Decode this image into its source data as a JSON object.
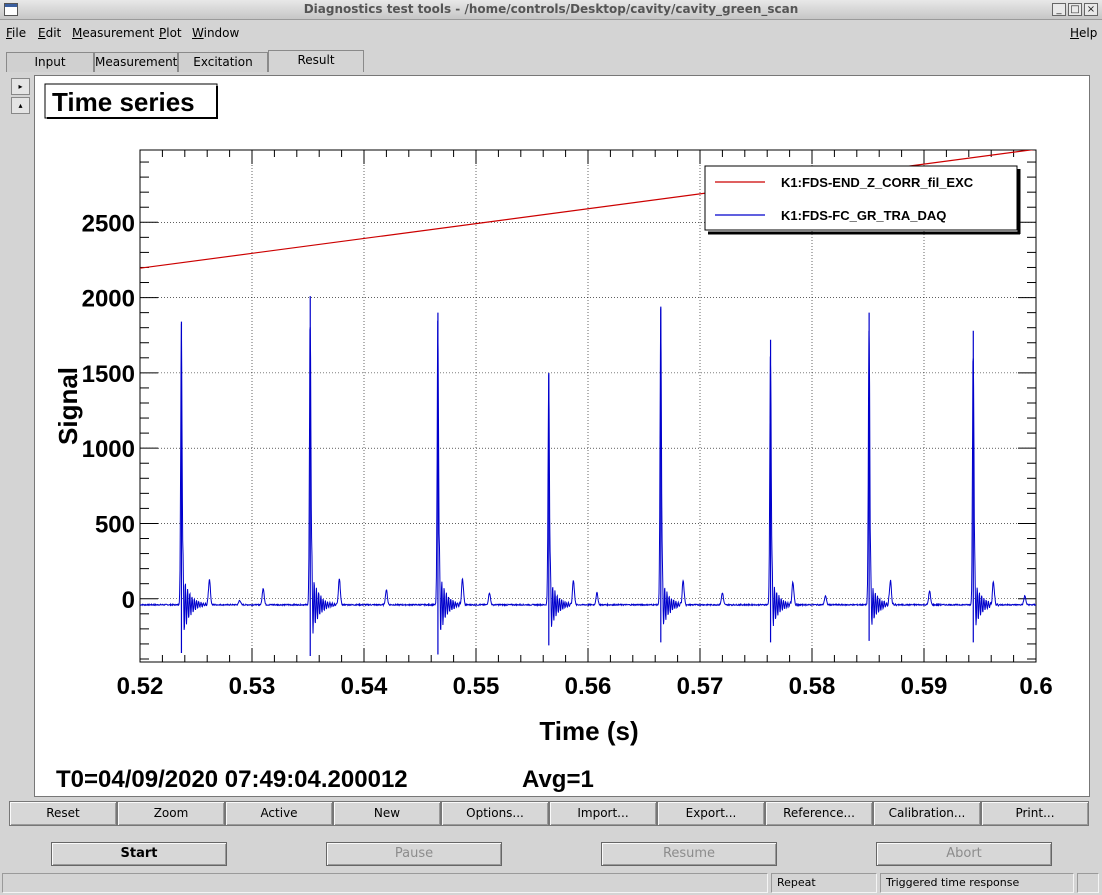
{
  "window": {
    "title": "Diagnostics test tools - /home/controls/Desktop/cavity/cavity_green_scan",
    "controls": [
      "_",
      "□",
      "×"
    ]
  },
  "menubar": {
    "items": [
      {
        "underline": "F",
        "rest": "ile"
      },
      {
        "underline": "E",
        "rest": "dit"
      },
      {
        "underline": "M",
        "rest": "easurement"
      },
      {
        "underline": "P",
        "rest": "lot"
      },
      {
        "underline": "W",
        "rest": "indow"
      }
    ],
    "help": {
      "underline": "H",
      "rest": "elp"
    }
  },
  "tabs": [
    "Input",
    "Measurement",
    "Excitation",
    "Result"
  ],
  "active_tab": "Result",
  "side_buttons": [
    "▸",
    "▴"
  ],
  "plot": {
    "title": "Time series",
    "info_t0": "T0=04/09/2020 07:49:04.200012",
    "info_avg": "Avg=1"
  },
  "chart_data": {
    "type": "line",
    "title": "Time series",
    "xlabel": "Time (s)",
    "ylabel": "Signal",
    "xlim": [
      0.52,
      0.6
    ],
    "ylim": [
      -420,
      2980
    ],
    "grid": true,
    "x_ticks": [
      "0.52",
      "0.53",
      "0.54",
      "0.55",
      "0.56",
      "0.57",
      "0.58",
      "0.59",
      "0.6"
    ],
    "y_ticks": [
      "0",
      "500",
      "1000",
      "1500",
      "2000",
      "2500"
    ],
    "legend_position": "top-right",
    "series": [
      {
        "name": "K1:FDS-END_Z_CORR_fil_EXC",
        "color": "#cc0000",
        "x": [
          0.52,
          0.6
        ],
        "y": [
          2195,
          2985
        ]
      },
      {
        "name": "K1:FDS-FC_GR_TRA_DAQ",
        "color": "#0000cc",
        "baseline": -40,
        "spikes": [
          {
            "x": 0.5237,
            "y": 1840,
            "min": -360
          },
          {
            "x": 0.5352,
            "y": 2010,
            "min": -380
          },
          {
            "x": 0.5466,
            "y": 1900,
            "min": -370
          },
          {
            "x": 0.5565,
            "y": 1500,
            "min": -310
          },
          {
            "x": 0.5665,
            "y": 1940,
            "min": -290
          },
          {
            "x": 0.5763,
            "y": 1720,
            "min": -290
          },
          {
            "x": 0.5851,
            "y": 1900,
            "min": -280
          },
          {
            "x": 0.5944,
            "y": 1780,
            "min": -290
          }
        ],
        "bumps": [
          {
            "x": 0.5262,
            "y": 130
          },
          {
            "x": 0.5289,
            "y": -10
          },
          {
            "x": 0.531,
            "y": 70
          },
          {
            "x": 0.5378,
            "y": 130
          },
          {
            "x": 0.542,
            "y": 60
          },
          {
            "x": 0.5488,
            "y": 130
          },
          {
            "x": 0.5512,
            "y": 40
          },
          {
            "x": 0.5587,
            "y": 120
          },
          {
            "x": 0.5608,
            "y": 40
          },
          {
            "x": 0.5685,
            "y": 120
          },
          {
            "x": 0.572,
            "y": 40
          },
          {
            "x": 0.5783,
            "y": 110
          },
          {
            "x": 0.5812,
            "y": 20
          },
          {
            "x": 0.587,
            "y": 120
          },
          {
            "x": 0.5905,
            "y": 50
          },
          {
            "x": 0.5962,
            "y": 110
          },
          {
            "x": 0.599,
            "y": 20
          }
        ]
      }
    ]
  },
  "toolbar": [
    "Reset",
    "Zoom",
    "Active",
    "New",
    "Options...",
    "Import...",
    "Export...",
    "Reference...",
    "Calibration...",
    "Print..."
  ],
  "controls": [
    {
      "label": "Start",
      "enabled": true
    },
    {
      "label": "Pause",
      "enabled": false
    },
    {
      "label": "Resume",
      "enabled": false
    },
    {
      "label": "Abort",
      "enabled": false
    }
  ],
  "status": {
    "main": "",
    "mode": "Repeat",
    "measurement": "Triggered time response"
  }
}
